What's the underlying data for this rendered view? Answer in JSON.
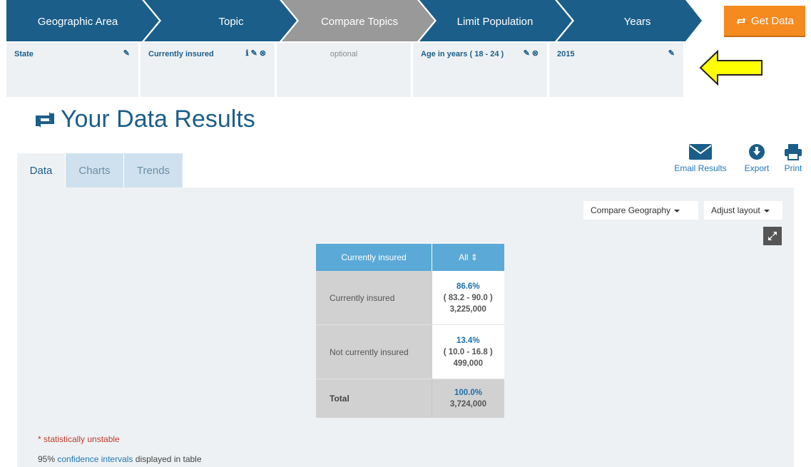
{
  "wizard": {
    "steps": [
      {
        "label": "Geographic Area"
      },
      {
        "label": "Topic"
      },
      {
        "label": "Compare Topics"
      },
      {
        "label": "Limit Population"
      },
      {
        "label": "Years"
      }
    ],
    "get_data_label": "Get Data",
    "colors": {
      "step": "#1b5e8a",
      "step_active": "#999999",
      "get_data": "#f58a1f"
    }
  },
  "selections": {
    "geographic_area": "State",
    "topic": "Currently insured",
    "compare_topics": "optional",
    "limit_population": "Age in years ( 18 - 24 )",
    "years": "2015"
  },
  "results": {
    "title": "Your Data Results",
    "tabs": [
      "Data",
      "Charts",
      "Trends"
    ],
    "active_tab": "Data",
    "tools": {
      "email": "Email Results",
      "export": "Export",
      "print": "Print"
    },
    "dropdowns": {
      "compare_geography": "Compare Geography",
      "adjust_layout": "Adjust layout"
    }
  },
  "table": {
    "header_row_label": "Currently insured",
    "header_col": "All",
    "rows": [
      {
        "label": "Currently insured",
        "pct": "86.6%",
        "ci": "( 83.2 - 90.0 )",
        "count": "3,225,000"
      },
      {
        "label": "Not currently insured",
        "pct": "13.4%",
        "ci": "( 10.0 - 16.8 )",
        "count": "499,000"
      }
    ],
    "total": {
      "label": "Total",
      "pct": "100.0%",
      "count": "3,724,000"
    }
  },
  "footnotes": {
    "unstable": "* statistically unstable",
    "ci_prefix": "95%",
    "ci_link": "confidence intervals",
    "ci_suffix": "displayed in table"
  }
}
